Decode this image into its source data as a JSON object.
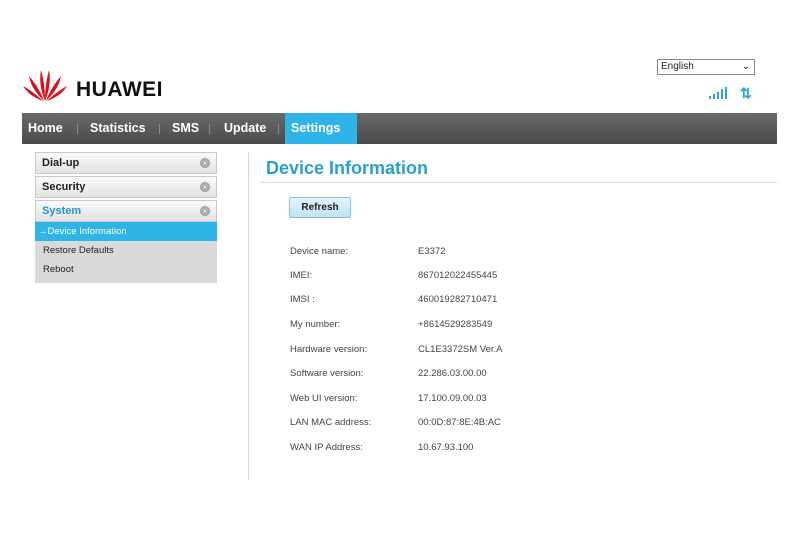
{
  "header": {
    "brand": "HUAWEI",
    "language": {
      "selected": "English"
    },
    "colors": {
      "brand_red": "#d7121a",
      "accent": "#2eb4e6"
    },
    "icons": {
      "signal": "signal-strength-icon",
      "transfer": "data-transfer-icon"
    }
  },
  "nav": {
    "items": [
      "Home",
      "Statistics",
      "SMS",
      "Update",
      "Settings"
    ],
    "active": "Settings"
  },
  "sidebar": {
    "sections": [
      "Dial-up",
      "Security",
      "System"
    ],
    "system_items": [
      "→Device Information",
      "Restore Defaults",
      "Reboot"
    ],
    "active_item": "Device Information"
  },
  "main": {
    "title": "Device Information",
    "refresh_label": "Refresh",
    "rows": [
      {
        "label": "Device name:",
        "value": "E3372"
      },
      {
        "label": "IMEI:",
        "value": "867012022455445"
      },
      {
        "label": "IMSI :",
        "value": "460019282710471"
      },
      {
        "label": "My number:",
        "value": "+8614529283549"
      },
      {
        "label": "Hardware version:",
        "value": "CL1E3372SM Ver.A"
      },
      {
        "label": "Software version:",
        "value": "22.286.03.00.00"
      },
      {
        "label": "Web UI version:",
        "value": "17.100.09.00.03"
      },
      {
        "label": "LAN MAC address:",
        "value": "00:0D:87:8E:4B:AC"
      },
      {
        "label": "WAN IP Address:",
        "value": "10.67.93.100"
      }
    ]
  }
}
